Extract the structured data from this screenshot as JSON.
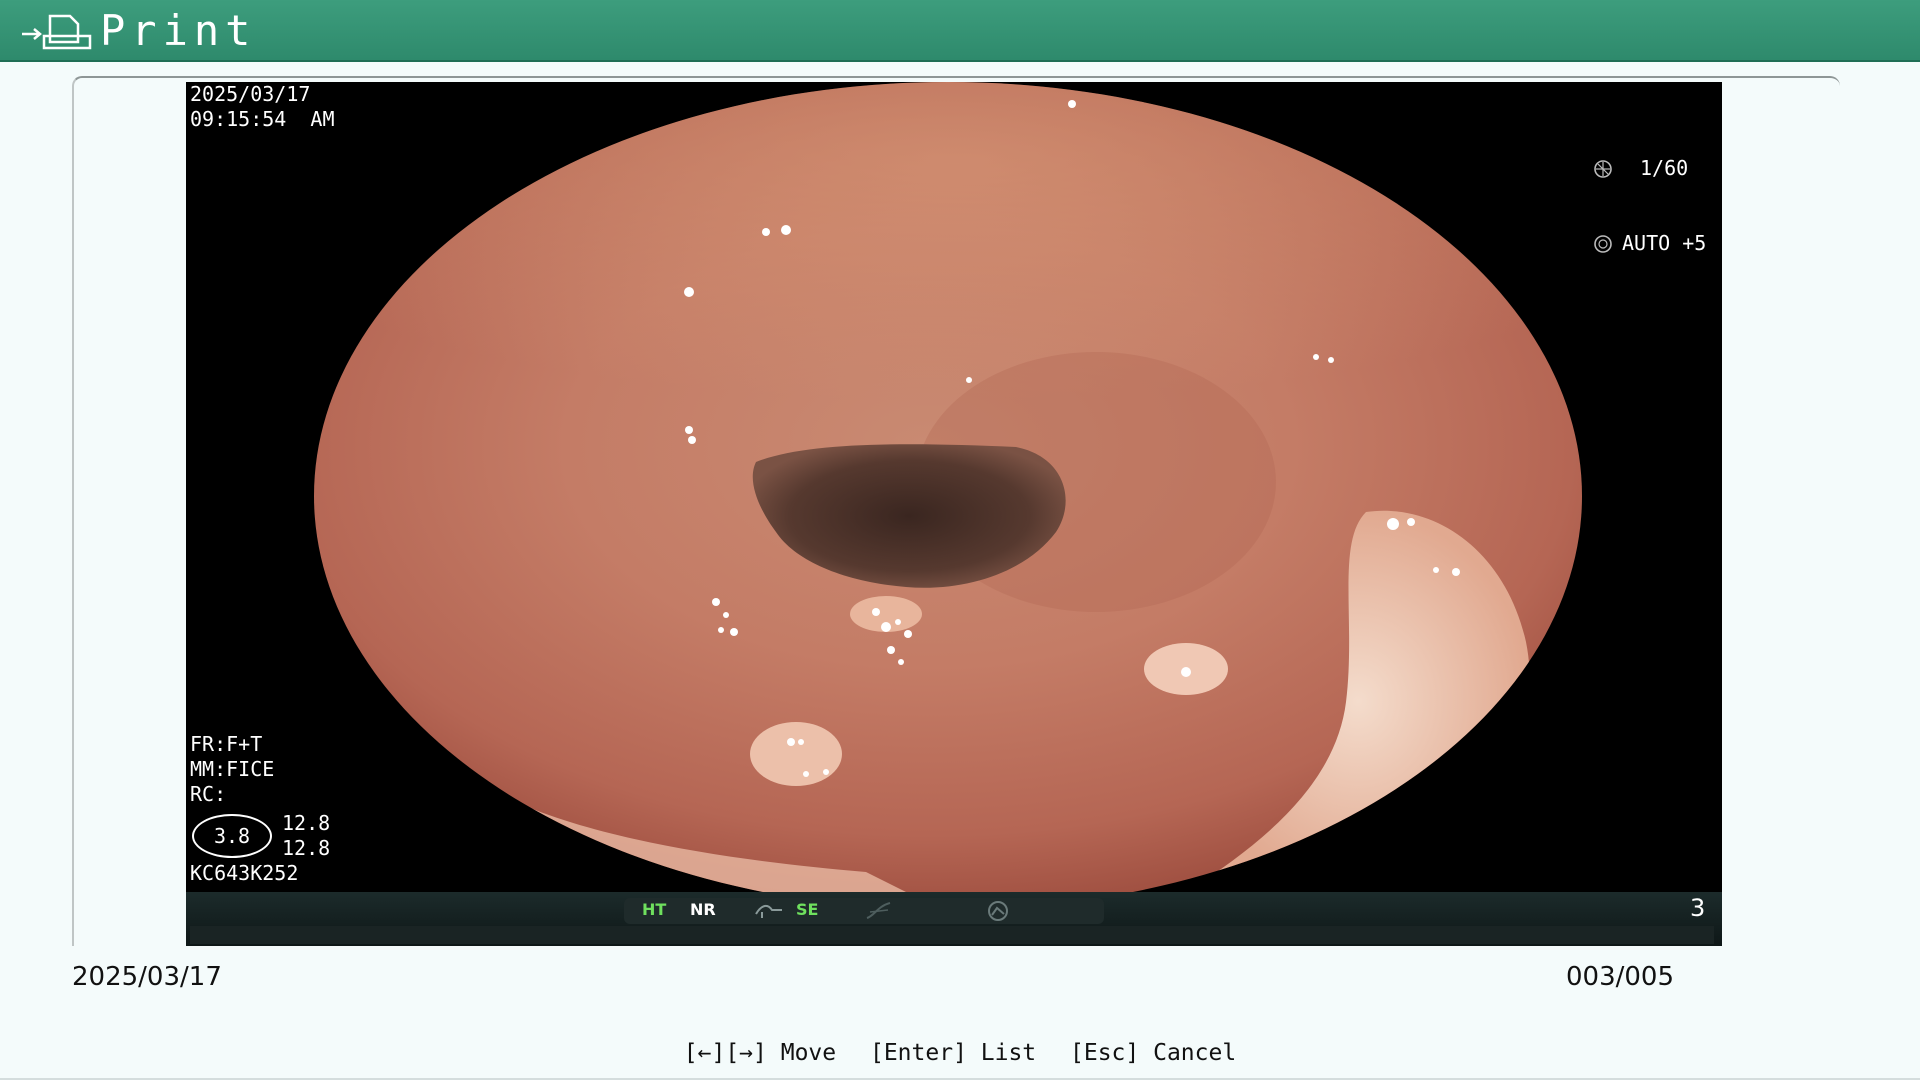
{
  "window": {
    "title": "Print",
    "icon": "print-arrow-icon"
  },
  "image": {
    "date": "2025/03/17",
    "time": "09:15:54  AM",
    "shutter": "1/60",
    "iris": "AUTO +5",
    "shutter_icon": "shutter-icon",
    "iris_icon": "iris-icon",
    "fr": "FR:F+T",
    "mm": "MM:FICE",
    "rc": "RC:",
    "rc_value": "3.8",
    "rc_values": "12.8\n12.8",
    "scope_id": "KC643K252",
    "modes": {
      "ht": "HT",
      "nr": "NR",
      "se": "SE"
    },
    "frame_index": "3",
    "colors": {
      "mode_active": "#6fe05e",
      "titlebar": "#3d9d7d"
    }
  },
  "footer": {
    "date": "2025/03/17",
    "counter": "003/005"
  },
  "help": {
    "move": "[←][→] Move",
    "list": "[Enter] List",
    "cancel": "[Esc] Cancel"
  }
}
